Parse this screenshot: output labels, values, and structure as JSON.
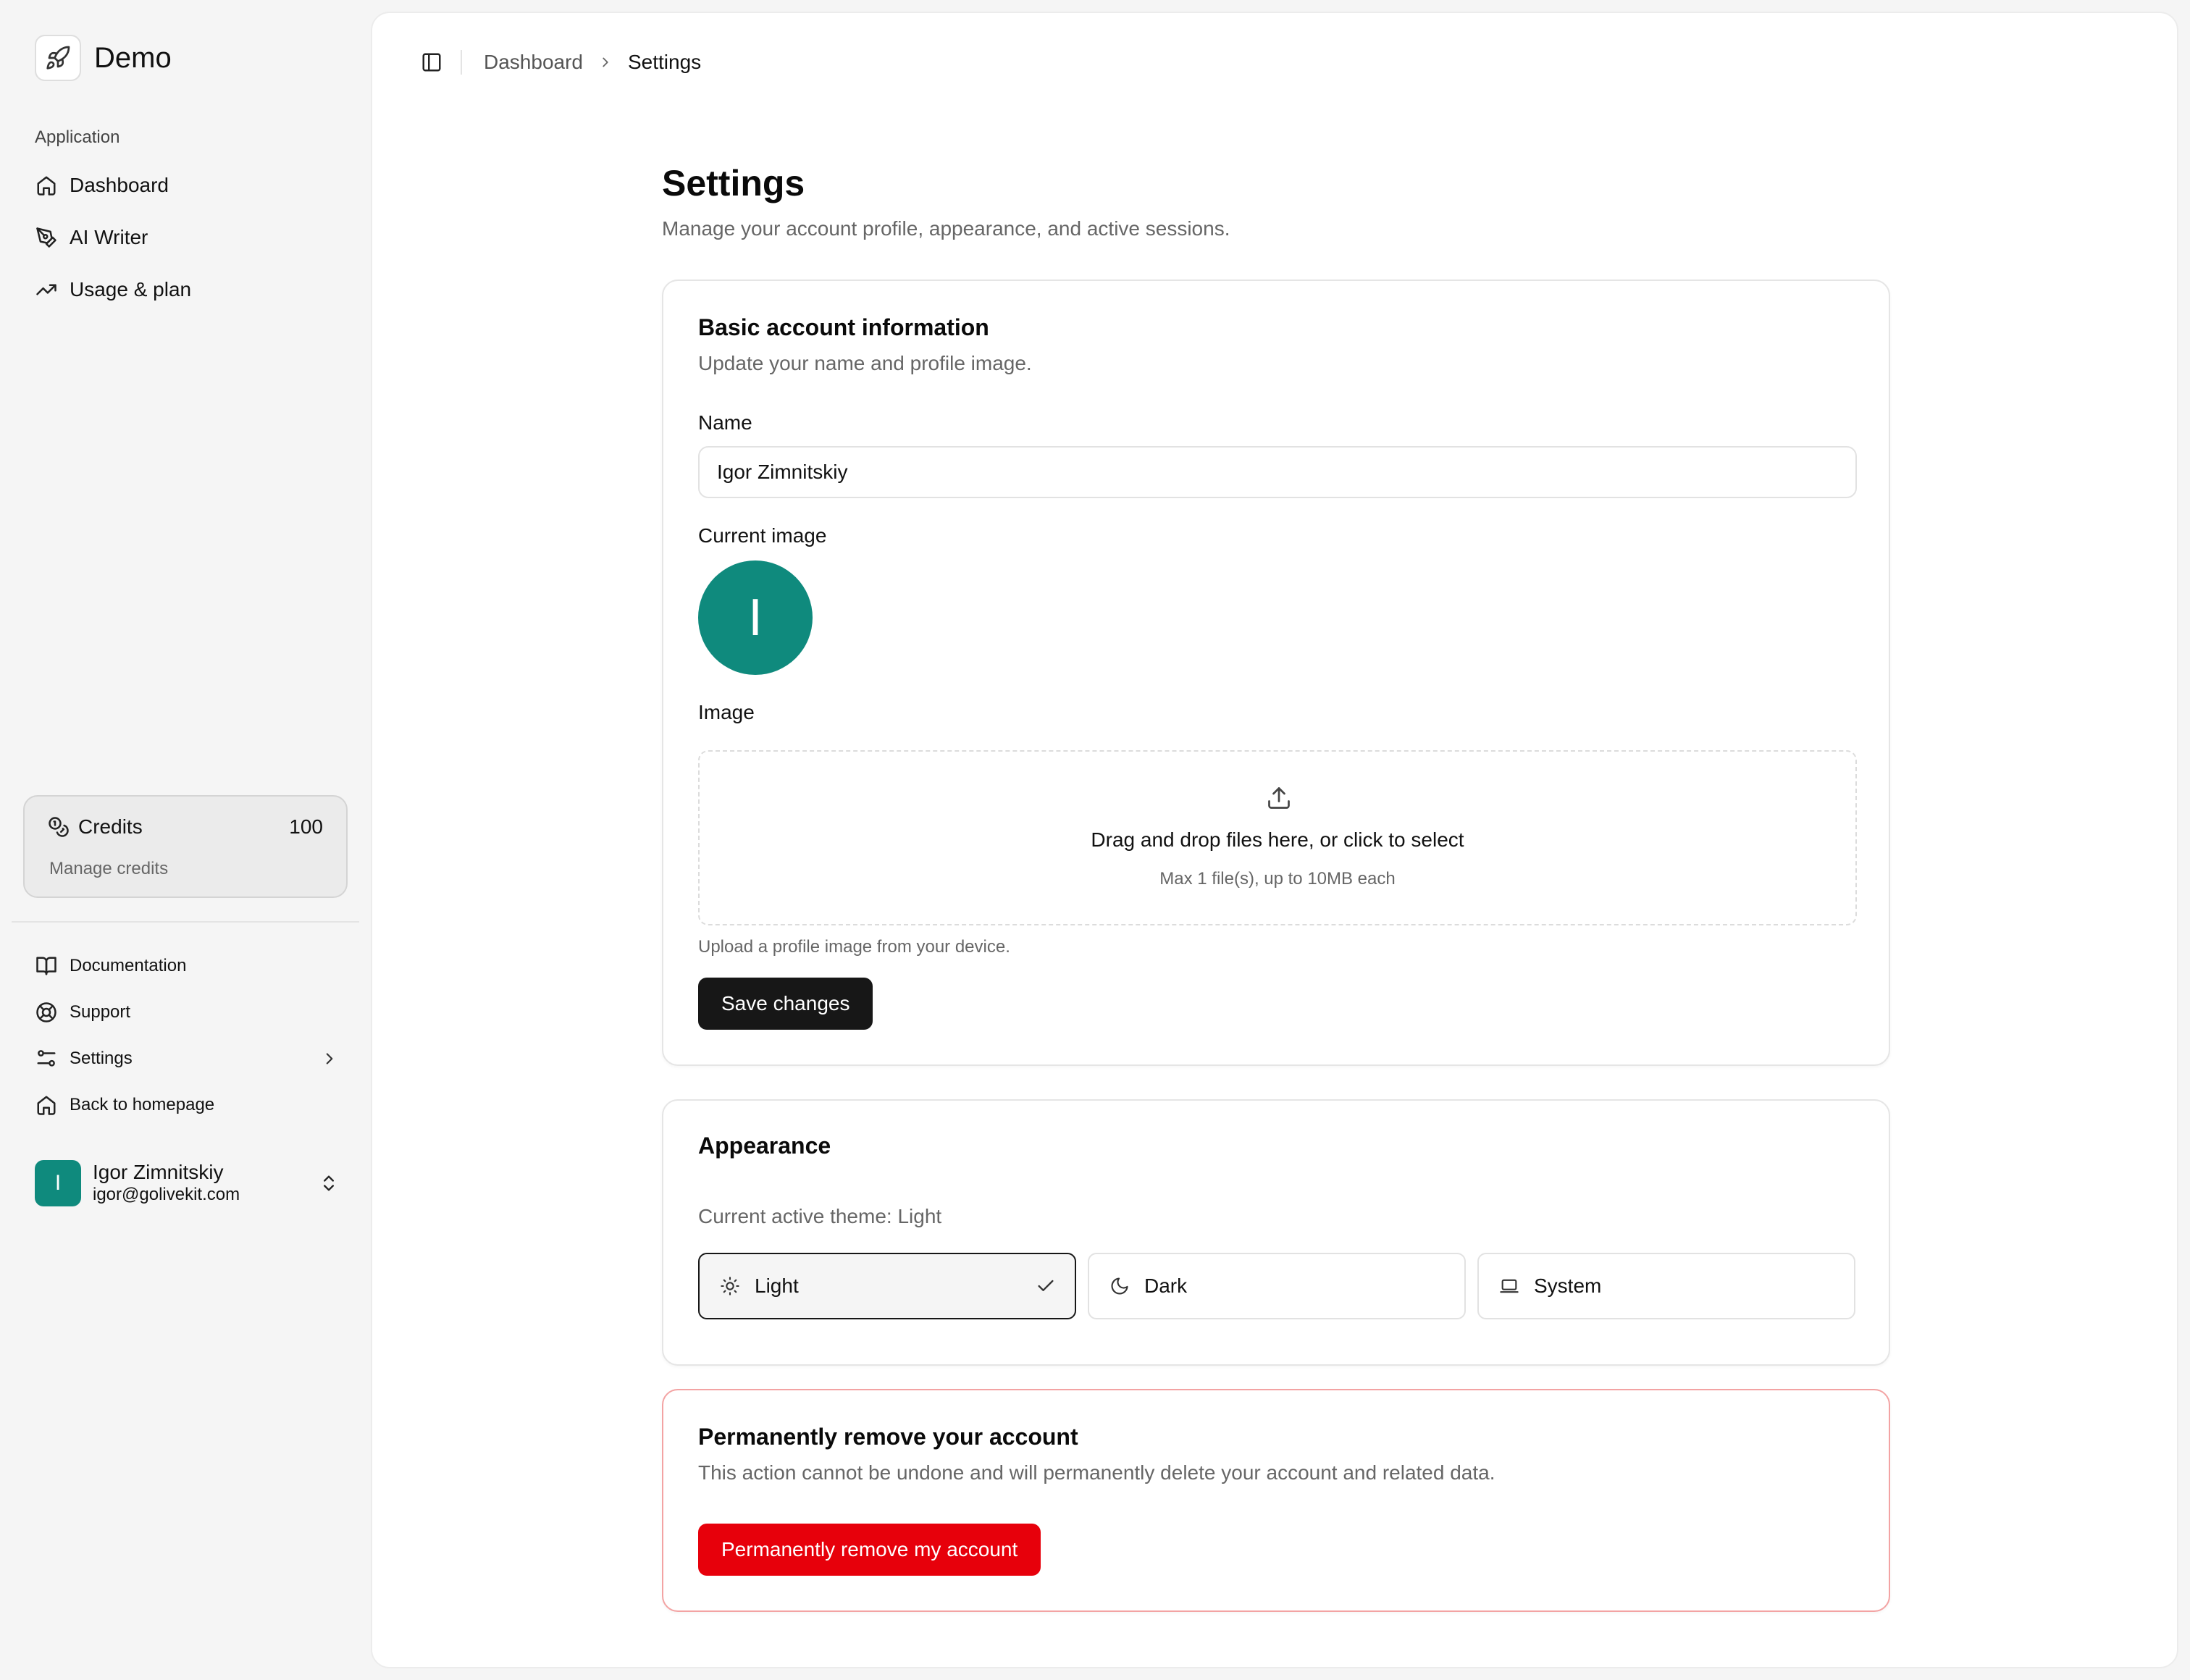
{
  "app": {
    "name": "Demo",
    "brand_icon": "rocket-icon"
  },
  "sidebar": {
    "group_label": "Application",
    "items": [
      {
        "label": "Dashboard",
        "icon": "home-icon"
      },
      {
        "label": "AI Writer",
        "icon": "pen-icon"
      },
      {
        "label": "Usage & plan",
        "icon": "trending-up-icon"
      }
    ],
    "credits": {
      "label": "Credits",
      "count": "100",
      "sub": "Manage credits",
      "icon": "coins-icon"
    },
    "footer_items": [
      {
        "label": "Documentation",
        "icon": "book-icon"
      },
      {
        "label": "Support",
        "icon": "life-buoy-icon"
      },
      {
        "label": "Settings",
        "icon": "settings-sliders-icon"
      },
      {
        "label": "Back to homepage",
        "icon": "home-icon"
      }
    ],
    "user": {
      "initial": "I",
      "name": "Igor Zimnitskiy",
      "email": "igor@golivekit.com"
    }
  },
  "breadcrumb": {
    "parent": "Dashboard",
    "current": "Settings"
  },
  "page": {
    "title": "Settings",
    "subtitle": "Manage your account profile, appearance, and active sessions."
  },
  "basic": {
    "title": "Basic account information",
    "description": "Update your name and profile image.",
    "name_label": "Name",
    "name_value": "Igor Zimnitskiy",
    "current_image_label": "Current image",
    "avatar_initial": "I",
    "image_label": "Image",
    "dropzone_text": "Drag and drop files here, or click to select",
    "dropzone_sub": "Max 1 file(s), up to 10MB each",
    "helper": "Upload a profile image from your device.",
    "save_label": "Save changes"
  },
  "appearance": {
    "title": "Appearance",
    "current_theme_text": "Current active theme: Light",
    "options": [
      {
        "label": "Light",
        "icon": "sun-icon",
        "selected": true
      },
      {
        "label": "Dark",
        "icon": "moon-icon",
        "selected": false
      },
      {
        "label": "System",
        "icon": "laptop-icon",
        "selected": false
      }
    ]
  },
  "danger": {
    "title": "Permanently remove your account",
    "description": "This action cannot be undone and will permanently delete your account and related data.",
    "button_label": "Permanently remove my account"
  },
  "colors": {
    "avatar": "#0f8a7d",
    "primary_button": "#171717",
    "danger_button": "#e7000b",
    "danger_border": "#f3a3a3"
  }
}
